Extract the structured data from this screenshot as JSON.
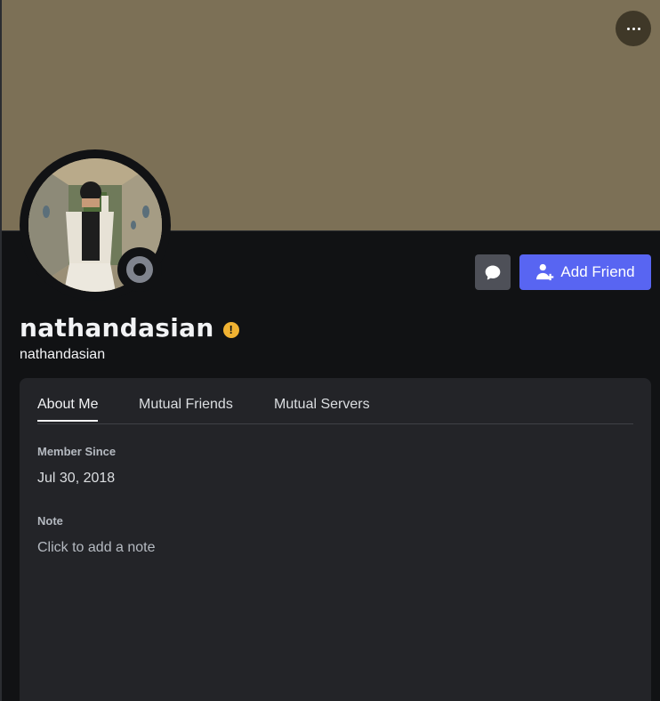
{
  "profile": {
    "display_name": "nathandasian",
    "username": "nathandasian",
    "status": "offline"
  },
  "actions": {
    "add_friend_label": "Add Friend",
    "message_icon": "chat-bubble-icon",
    "more_icon": "more-horizontal-icon"
  },
  "tabs": [
    {
      "label": "About Me",
      "active": true
    },
    {
      "label": "Mutual Friends",
      "active": false
    },
    {
      "label": "Mutual Servers",
      "active": false
    }
  ],
  "about": {
    "member_since_label": "Member Since",
    "member_since_value": "Jul 30, 2018",
    "note_label": "Note",
    "note_placeholder": "Click to add a note"
  },
  "colors": {
    "banner": "#7c7056",
    "background": "#111214",
    "card": "#232428",
    "accent": "#5865f2",
    "warning": "#f0b232",
    "status_offline": "#80848e"
  }
}
